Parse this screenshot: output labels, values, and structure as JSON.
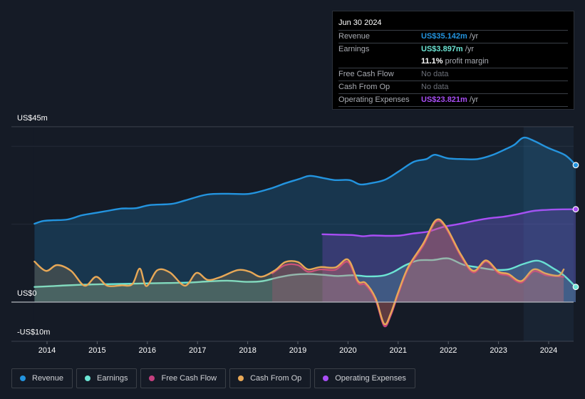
{
  "tooltip": {
    "date": "Jun 30 2024",
    "rows": [
      {
        "label": "Revenue",
        "value": "US$35.142m",
        "suffix": " /yr",
        "color": "#2394df"
      },
      {
        "label": "Earnings",
        "value": "US$3.897m",
        "suffix": " /yr",
        "color": "#6ce5d4"
      },
      {
        "label": "",
        "value": "11.1%",
        "suffix": " profit margin",
        "color": "#ffffff"
      },
      {
        "label": "Free Cash Flow",
        "value": "No data",
        "suffix": "",
        "color": "#6c7079"
      },
      {
        "label": "Cash From Op",
        "value": "No data",
        "suffix": "",
        "color": "#6c7079"
      },
      {
        "label": "Operating Expenses",
        "value": "US$23.821m",
        "suffix": " /yr",
        "color": "#a94ef5"
      }
    ]
  },
  "legend": [
    {
      "label": "Revenue",
      "color": "#2394df"
    },
    {
      "label": "Earnings",
      "color": "#6ce5d4"
    },
    {
      "label": "Free Cash Flow",
      "color": "#c4407f"
    },
    {
      "label": "Cash From Op",
      "color": "#e8a857"
    },
    {
      "label": "Operating Expenses",
      "color": "#a94ef5"
    }
  ],
  "chart_data": {
    "type": "line",
    "title": "",
    "xlabel": "",
    "ylabel": "",
    "x_ticks": [
      "2014",
      "2015",
      "2016",
      "2017",
      "2018",
      "2019",
      "2020",
      "2021",
      "2022",
      "2023",
      "2024"
    ],
    "y_ticks": [
      {
        "value": 45,
        "label": "US$45m"
      },
      {
        "value": 0,
        "label": "US$0"
      },
      {
        "value": -10,
        "label": "-US$10m"
      }
    ],
    "ylim": [
      -10,
      45
    ],
    "xlim": [
      2013.74,
      2024.54
    ],
    "grid": true,
    "highlight_from": 2023.5,
    "series": [
      {
        "name": "Revenue",
        "color": "#2394df",
        "fill": true,
        "x": [
          2013.75,
          2013.92,
          2014.13,
          2014.41,
          2014.7,
          2014.98,
          2015.2,
          2015.48,
          2015.77,
          2016.05,
          2016.48,
          2016.76,
          2017.19,
          2017.61,
          2018.04,
          2018.47,
          2018.75,
          2019.03,
          2019.24,
          2019.52,
          2019.74,
          2020.03,
          2020.24,
          2020.45,
          2020.74,
          2021.02,
          2021.31,
          2021.56,
          2021.73,
          2021.99,
          2022.3,
          2022.58,
          2022.87,
          2023.15,
          2023.32,
          2023.5,
          2023.72,
          2024.0,
          2024.33,
          2024.54
        ],
        "values": [
          20.1,
          20.8,
          21.0,
          21.2,
          22.3,
          22.9,
          23.4,
          24.0,
          24.1,
          24.9,
          25.2,
          26.1,
          27.6,
          27.8,
          27.8,
          29.2,
          30.5,
          31.6,
          32.4,
          31.8,
          31.3,
          31.3,
          30.2,
          30.5,
          31.4,
          33.6,
          36.0,
          36.7,
          37.8,
          36.9,
          36.7,
          36.7,
          37.7,
          39.3,
          40.4,
          42.2,
          41.3,
          39.5,
          37.7,
          35.142
        ]
      },
      {
        "name": "Operating Expenses",
        "color": "#a94ef5",
        "fill": true,
        "x": [
          2019.49,
          2019.8,
          2020.1,
          2020.3,
          2020.5,
          2020.8,
          2021.05,
          2021.3,
          2021.6,
          2021.9,
          2022.2,
          2022.5,
          2022.8,
          2023.1,
          2023.4,
          2023.7,
          2024.0,
          2024.3,
          2024.54
        ],
        "values": [
          17.4,
          17.3,
          17.2,
          16.9,
          17.1,
          17.0,
          17.1,
          17.6,
          18.1,
          19.3,
          20.0,
          20.8,
          21.5,
          21.9,
          22.6,
          23.4,
          23.7,
          23.8,
          23.821
        ]
      },
      {
        "name": "Earnings",
        "color": "#6ce5d4",
        "fill": true,
        "x": [
          2013.75,
          2014.1,
          2014.4,
          2014.8,
          2015.2,
          2015.6,
          2016.0,
          2016.4,
          2016.8,
          2017.2,
          2017.6,
          2018.0,
          2018.3,
          2018.6,
          2018.9,
          2019.2,
          2019.5,
          2019.8,
          2020.1,
          2020.4,
          2020.7,
          2020.9,
          2021.15,
          2021.4,
          2021.7,
          2022.0,
          2022.3,
          2022.6,
          2022.9,
          2023.2,
          2023.5,
          2023.8,
          2024.1,
          2024.3,
          2024.54
        ],
        "values": [
          3.9,
          4.1,
          4.3,
          4.5,
          4.6,
          4.7,
          4.8,
          4.9,
          5.0,
          5.3,
          5.5,
          5.2,
          5.4,
          6.3,
          7.0,
          7.2,
          7.0,
          6.7,
          6.9,
          6.6,
          6.8,
          7.7,
          9.5,
          10.7,
          10.8,
          11.2,
          9.6,
          8.9,
          8.3,
          8.4,
          9.8,
          10.6,
          8.6,
          6.9,
          3.897
        ]
      },
      {
        "name": "Free Cash Flow",
        "color": "#c4407f",
        "fill": true,
        "x": [
          2018.49,
          2018.75,
          2019.0,
          2019.2,
          2019.45,
          2019.75,
          2020.0,
          2020.2,
          2020.35,
          2020.55,
          2020.72,
          2020.85,
          2021.0,
          2021.2,
          2021.5,
          2021.75,
          2021.95,
          2022.25,
          2022.5,
          2022.75,
          2023.0,
          2023.2,
          2023.45,
          2023.7,
          2023.95,
          2024.2,
          2024.3
        ],
        "values": [
          7.4,
          9.5,
          9.5,
          7.8,
          8.4,
          8.3,
          10.3,
          4.9,
          4.4,
          0.5,
          -6.1,
          -3.5,
          2.0,
          8.6,
          14.5,
          20.6,
          19.0,
          11.8,
          7.6,
          10.4,
          7.4,
          6.8,
          5.0,
          7.9,
          6.9,
          6.6,
          6.5
        ]
      },
      {
        "name": "Cash From Op",
        "color": "#e8a857",
        "fill": true,
        "x": [
          2013.75,
          2013.98,
          2014.2,
          2014.48,
          2014.75,
          2014.98,
          2015.2,
          2015.48,
          2015.7,
          2015.85,
          2015.98,
          2016.2,
          2016.45,
          2016.75,
          2016.98,
          2017.2,
          2017.45,
          2017.8,
          2018.04,
          2018.27,
          2018.55,
          2018.75,
          2019.0,
          2019.2,
          2019.45,
          2019.75,
          2020.0,
          2020.2,
          2020.35,
          2020.55,
          2020.72,
          2020.85,
          2021.0,
          2021.2,
          2021.5,
          2021.75,
          2021.95,
          2022.25,
          2022.5,
          2022.75,
          2023.0,
          2023.2,
          2023.45,
          2023.7,
          2023.95,
          2024.2,
          2024.3
        ],
        "values": [
          10.4,
          8.0,
          9.5,
          8.0,
          4.2,
          6.5,
          4.2,
          4.3,
          4.6,
          8.6,
          4.1,
          8.2,
          7.6,
          4.2,
          7.5,
          5.7,
          6.4,
          8.2,
          7.8,
          6.5,
          8.2,
          10.3,
          10.3,
          8.4,
          9.0,
          8.9,
          10.9,
          5.4,
          4.9,
          1.0,
          -5.6,
          -3.0,
          2.5,
          9.0,
          15.0,
          21.0,
          19.4,
          12.2,
          8.0,
          10.7,
          7.8,
          7.2,
          5.4,
          8.4,
          7.3,
          6.8,
          8.4
        ]
      }
    ]
  }
}
